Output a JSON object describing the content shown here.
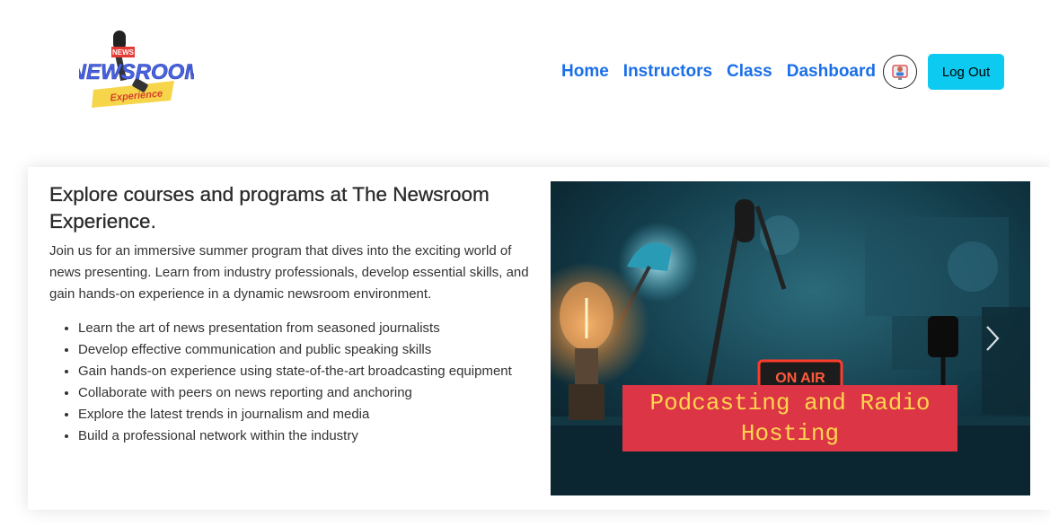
{
  "header": {
    "logo": {
      "brand": "NEWSROOM",
      "badge": "NEWS",
      "tagline": "Experience"
    },
    "nav": [
      {
        "label": "Home"
      },
      {
        "label": "Instructors"
      },
      {
        "label": "Class"
      },
      {
        "label": "Dashboard"
      }
    ],
    "avatar_icon": "user-avatar-icon",
    "logout_label": "Log Out"
  },
  "main": {
    "title": "Explore courses and programs at The Newsroom Experience.",
    "description": "Join us for an immersive summer program that dives into the exciting world of news presenting. Learn from industry professionals, develop essential skills, and gain hands-on experience in a dynamic newsroom environment.",
    "bullets": [
      "Learn the art of news presentation from seasoned journalists",
      "Develop effective communication and public speaking skills",
      "Gain hands-on experience using state-of-the-art broadcasting equipment",
      "Collaborate with peers on news reporting and anchoring",
      "Explore the latest trends in journalism and media",
      "Build a professional network within the industry"
    ],
    "carousel": {
      "caption": "Podcasting and Radio Hosting",
      "image_sign": "ON AIR",
      "next_icon": "chevron-right-icon"
    }
  },
  "colors": {
    "nav_link": "#1a6fe8",
    "logout_bg": "#0dcaf0",
    "caption_bg": "#dc3545",
    "caption_text": "#ffd54f"
  }
}
